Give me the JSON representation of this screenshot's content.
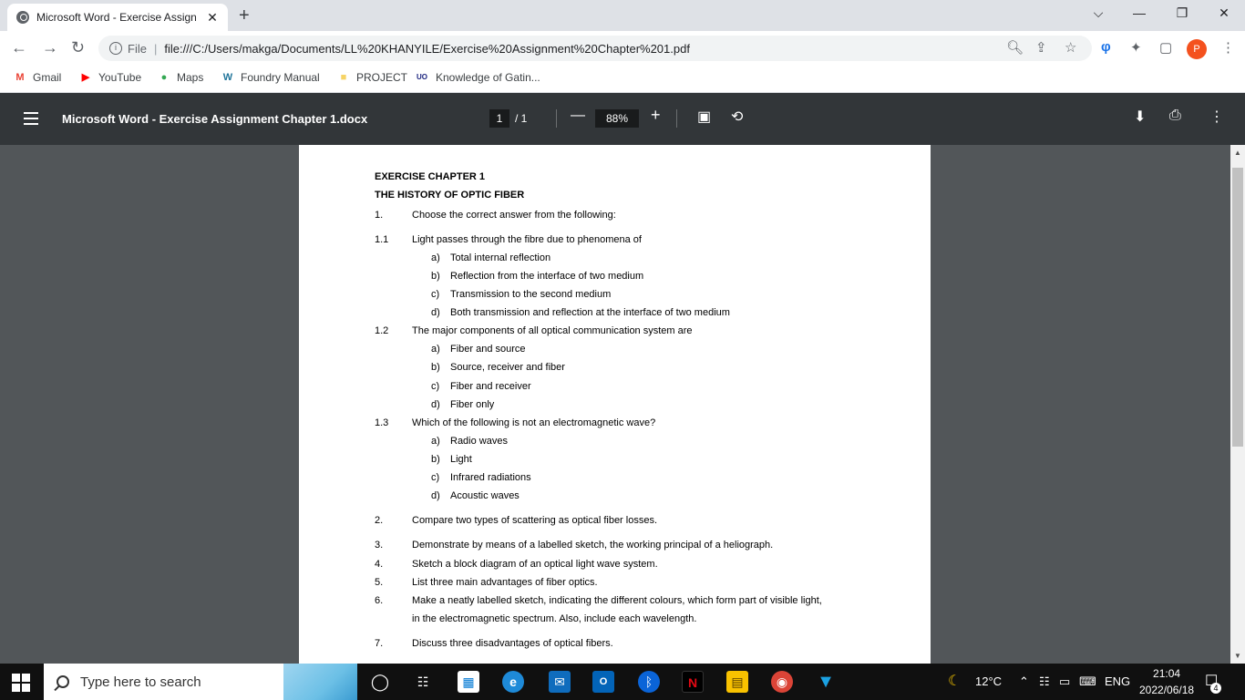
{
  "browser": {
    "tab_title": "Microsoft Word - Exercise Assign",
    "tab_close": "✕",
    "new_tab": "+",
    "window_controls": {
      "dropdown": "⌵",
      "minimize": "—",
      "restore": "❐",
      "close": "✕"
    },
    "nav": {
      "back": "←",
      "forward": "→",
      "reload": "↻"
    },
    "address": {
      "scheme_label": "File",
      "separator": "|",
      "url": "file:///C:/Users/makga/Documents/LL%20KHANYILE/Exercise%20Assignment%20Chapter%201.pdf"
    },
    "profile_initial": "P",
    "bookmarks": [
      {
        "label": "Gmail",
        "icon": "gmail-icon",
        "glyph": "M",
        "color": "#ea4335"
      },
      {
        "label": "YouTube",
        "icon": "youtube-icon",
        "glyph": "▶",
        "color": "#ff0000"
      },
      {
        "label": "Maps",
        "icon": "maps-icon",
        "glyph": "●",
        "color": "#34a853"
      },
      {
        "label": "Foundry Manual",
        "icon": "wordpress-icon",
        "glyph": "W",
        "color": "#21759b"
      },
      {
        "label": "PROJECT",
        "icon": "folder-icon",
        "glyph": "■",
        "color": "#f6d365"
      },
      {
        "label": "Knowledge of Gatin...",
        "icon": "uo-icon",
        "glyph": "UO",
        "color": "#1a237e"
      }
    ]
  },
  "pdf_toolbar": {
    "title": "Microsoft Word - Exercise Assignment Chapter 1.docx",
    "current_page": "1",
    "total_pages": "/ 1",
    "zoom_out": "—",
    "zoom": "88%",
    "zoom_in": "+"
  },
  "document": {
    "heading1": "EXERCISE CHAPTER 1",
    "heading2": "THE HISTORY OF OPTIC FIBER",
    "lines": [
      {
        "num": "1.",
        "text": "Choose the correct answer from the following:"
      },
      {
        "num": "1.1",
        "text": "Light passes through the fibre due to phenomena of"
      },
      {
        "num": "a)",
        "text": "Total internal reflection"
      },
      {
        "num": "b)",
        "text": "Reflection from the interface of two medium"
      },
      {
        "num": "c)",
        "text": "Transmission to the second medium"
      },
      {
        "num": "d)",
        "text": "Both transmission and reflection at the interface of two medium"
      },
      {
        "num": "1.2",
        "text": "The major components of all optical communication system are"
      },
      {
        "num": "a)",
        "text": "Fiber and source"
      },
      {
        "num": "b)",
        "text": "Source, receiver and fiber"
      },
      {
        "num": "c)",
        "text": "Fiber and receiver"
      },
      {
        "num": "d)",
        "text": "Fiber only"
      },
      {
        "num": "1.3",
        "text": "Which of the following is not an electromagnetic wave?"
      },
      {
        "num": "a)",
        "text": "Radio waves"
      },
      {
        "num": "b)",
        "text": "Light"
      },
      {
        "num": "c)",
        "text": "Infrared radiations"
      },
      {
        "num": "d)",
        "text": "Acoustic waves"
      },
      {
        "num": "2.",
        "text": "Compare two types of scattering as optical fiber losses."
      },
      {
        "num": "3.",
        "text": "Demonstrate by means of a labelled sketch, the working principal of a heliograph."
      },
      {
        "num": "4.",
        "text": "Sketch a block diagram of an optical light wave system."
      },
      {
        "num": "5.",
        "text": "List three main advantages of fiber optics."
      },
      {
        "num": "6.",
        "text": "Make a neatly labelled sketch, indicating the different colours, which form part of visible light,"
      },
      {
        "num": "",
        "text": "in the electromagnetic spectrum. Also, include each wavelength."
      },
      {
        "num": "7.",
        "text": "Discuss three disadvantages of optical fibers."
      }
    ]
  },
  "taskbar": {
    "search_placeholder": "Type here to search",
    "weather": "12°C",
    "language": "ENG",
    "time": "21:04",
    "date": "2022/06/18",
    "notification_count": "4"
  }
}
